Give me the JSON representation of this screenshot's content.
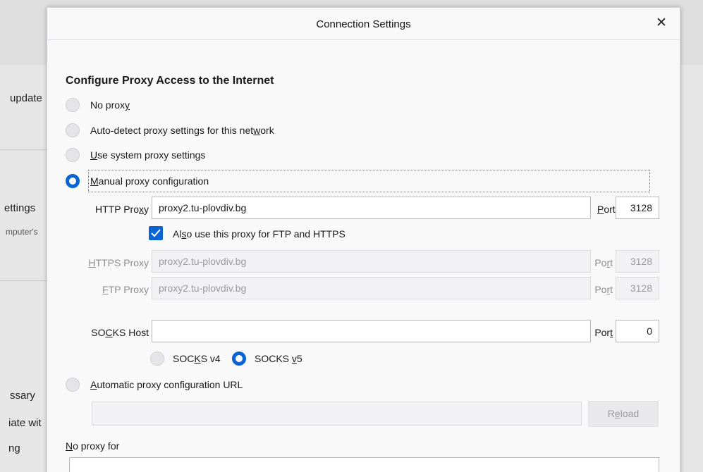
{
  "background": {
    "texts": [
      "update",
      "ettings",
      "mputer's",
      "ssary",
      "iate wit",
      "ng"
    ]
  },
  "dialog": {
    "title": "Connection Settings",
    "close_glyph": "✕"
  },
  "section": {
    "heading": "Configure Proxy Access to the Internet"
  },
  "proxy_modes": [
    {
      "pre": "No prox",
      "key": "y",
      "post": "",
      "checked": false
    },
    {
      "pre": "Auto-detect proxy settings for this net",
      "key": "w",
      "post": "ork",
      "checked": false
    },
    {
      "pre": "",
      "key": "U",
      "post": "se system proxy settings",
      "checked": false
    },
    {
      "pre": "",
      "key": "M",
      "post": "anual proxy configuration",
      "checked": true
    }
  ],
  "http": {
    "label_pre": "HTTP Pro",
    "label_key": "x",
    "label_post": "y",
    "value": "proxy2.tu-plovdiv.bg",
    "port_label_pre": "",
    "port_label_key": "P",
    "port_label_post": "ort",
    "port": "3128"
  },
  "share_proxy": {
    "checked": true,
    "label_pre": "Al",
    "label_key": "s",
    "label_post": "o use this proxy for FTP and HTTPS"
  },
  "https": {
    "label_pre": "",
    "label_key": "H",
    "label_post": "TTPS Proxy",
    "value": "proxy2.tu-plovdiv.bg",
    "port_label_pre": "Po",
    "port_label_key": "r",
    "port_label_post": "t",
    "port": "3128"
  },
  "ftp": {
    "label_pre": "",
    "label_key": "F",
    "label_post": "TP Proxy",
    "value": "proxy2.tu-plovdiv.bg",
    "port_label_pre": "Po",
    "port_label_key": "r",
    "port_label_post": "t",
    "port": "3128"
  },
  "socks": {
    "label_pre": "SO",
    "label_key": "C",
    "label_post": "KS Host",
    "value": "",
    "port_label_pre": "Por",
    "port_label_key": "t",
    "port_label_post": "",
    "port": "0",
    "v4": {
      "pre": "SOC",
      "key": "K",
      "post": "S v4",
      "checked": false
    },
    "v5": {
      "pre": "SOCKS ",
      "key": "v",
      "post": "5",
      "checked": true
    }
  },
  "auto_config": {
    "pre": "",
    "key": "A",
    "post": "utomatic proxy configuration URL",
    "checked": false,
    "url": "",
    "reload_pre": "R",
    "reload_key": "e",
    "reload_post": "load"
  },
  "no_proxy": {
    "pre": "",
    "key": "N",
    "post": "o proxy for",
    "value": ""
  },
  "colors": {
    "accent": "#0a64d4",
    "dialog_bg": "#f9f9fa",
    "disabled_text": "#9a9a9a"
  }
}
